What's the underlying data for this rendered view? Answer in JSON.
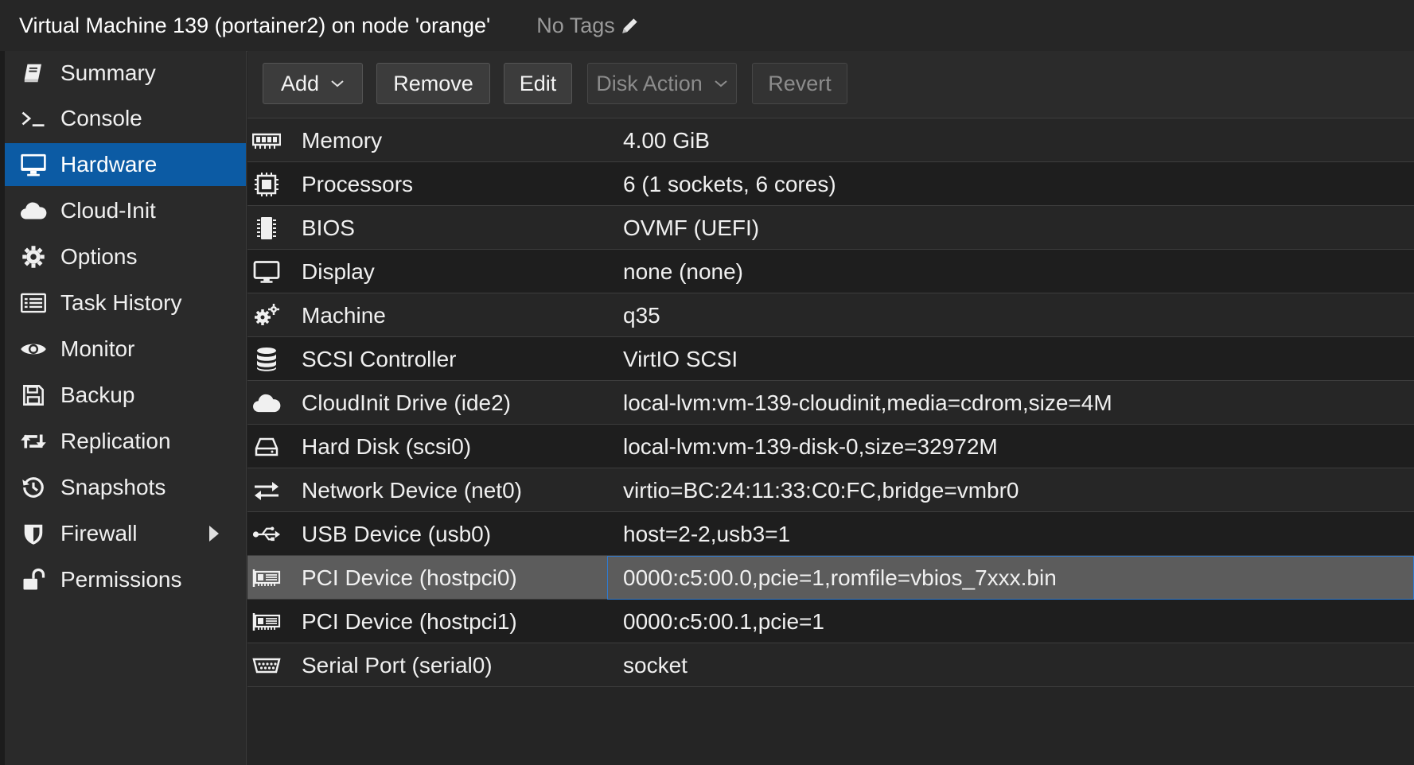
{
  "window": {
    "title": "Virtual Machine 139 (portainer2) on node 'orange'",
    "tags_label": "No Tags",
    "tags_icon": "pencil-icon"
  },
  "sidebar": {
    "active": "Hardware",
    "items": [
      {
        "label": "Summary",
        "icon": "book-icon"
      },
      {
        "label": "Console",
        "icon": "terminal-icon"
      },
      {
        "label": "Hardware",
        "icon": "desktop-icon"
      },
      {
        "label": "Cloud-Init",
        "icon": "cloud-icon"
      },
      {
        "label": "Options",
        "icon": "gear-icon"
      },
      {
        "label": "Task History",
        "icon": "list-icon"
      },
      {
        "label": "Monitor",
        "icon": "eye-icon"
      },
      {
        "label": "Backup",
        "icon": "floppy-icon"
      },
      {
        "label": "Replication",
        "icon": "retweet-icon"
      },
      {
        "label": "Snapshots",
        "icon": "history-icon"
      },
      {
        "label": "Firewall",
        "icon": "shield-icon"
      },
      {
        "label": "Permissions",
        "icon": "unlock-icon"
      }
    ]
  },
  "toolbar": {
    "add_label": "Add",
    "remove_label": "Remove",
    "edit_label": "Edit",
    "disk_action_label": "Disk Action",
    "revert_label": "Revert"
  },
  "hardware": {
    "rows": [
      {
        "name": "Memory",
        "value": "4.00 GiB",
        "icon": "memory-icon"
      },
      {
        "name": "Processors",
        "value": "6 (1 sockets, 6 cores)",
        "icon": "cpu-icon"
      },
      {
        "name": "BIOS",
        "value": "OVMF (UEFI)",
        "icon": "chip-icon"
      },
      {
        "name": "Display",
        "value": "none (none)",
        "icon": "desktop-icon"
      },
      {
        "name": "Machine",
        "value": "q35",
        "icon": "gears-icon"
      },
      {
        "name": "SCSI Controller",
        "value": "VirtIO SCSI",
        "icon": "database-icon"
      },
      {
        "name": "CloudInit Drive (ide2)",
        "value": "local-lvm:vm-139-cloudinit,media=cdrom,size=4M",
        "icon": "cloud-icon"
      },
      {
        "name": "Hard Disk (scsi0)",
        "value": "local-lvm:vm-139-disk-0,size=32972M",
        "icon": "hdd-icon"
      },
      {
        "name": "Network Device (net0)",
        "value": "virtio=BC:24:11:33:C0:FC,bridge=vmbr0",
        "icon": "exchange-icon"
      },
      {
        "name": "USB Device (usb0)",
        "value": "host=2-2,usb3=1",
        "icon": "usb-icon"
      },
      {
        "name": "PCI Device (hostpci0)",
        "value": "0000:c5:00.0,pcie=1,romfile=vbios_7xxx.bin",
        "icon": "pci-card-icon"
      },
      {
        "name": "PCI Device (hostpci1)",
        "value": "0000:c5:00.1,pcie=1",
        "icon": "pci-card-icon"
      },
      {
        "name": "Serial Port (serial0)",
        "value": "socket",
        "icon": "serial-port-icon"
      }
    ],
    "selected": "PCI Device (hostpci0)"
  },
  "colors": {
    "active_nav": "#0c5ba4",
    "selected_row": "#5c5c5c",
    "focus_border": "#2f7ad0"
  }
}
